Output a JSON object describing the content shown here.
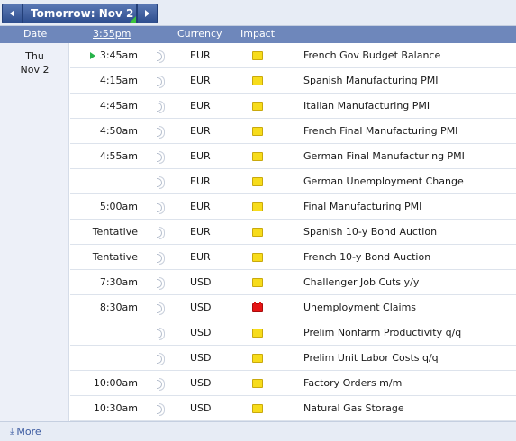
{
  "nav": {
    "prev_icon": "chevron-left-icon",
    "title": "Tomorrow: Nov 2",
    "next_icon": "chevron-right-icon"
  },
  "columns": {
    "date": "Date",
    "time": "3:55pm",
    "currency": "Currency",
    "impact": "Impact"
  },
  "day": {
    "weekday": "Thu",
    "date": "Nov 2"
  },
  "events": [
    {
      "time": "3:45am",
      "currency": "EUR",
      "impact": "low",
      "event": "French Gov Budget Balance",
      "next": true
    },
    {
      "time": "4:15am",
      "currency": "EUR",
      "impact": "low",
      "event": "Spanish Manufacturing PMI"
    },
    {
      "time": "4:45am",
      "currency": "EUR",
      "impact": "low",
      "event": "Italian Manufacturing PMI"
    },
    {
      "time": "4:50am",
      "currency": "EUR",
      "impact": "low",
      "event": "French Final Manufacturing PMI"
    },
    {
      "time": "4:55am",
      "currency": "EUR",
      "impact": "low",
      "event": "German Final Manufacturing PMI"
    },
    {
      "time": "",
      "currency": "EUR",
      "impact": "low",
      "event": "German Unemployment Change"
    },
    {
      "time": "5:00am",
      "currency": "EUR",
      "impact": "low",
      "event": "Final Manufacturing PMI"
    },
    {
      "time": "Tentative",
      "currency": "EUR",
      "impact": "low",
      "event": "Spanish 10-y Bond Auction"
    },
    {
      "time": "Tentative",
      "currency": "EUR",
      "impact": "low",
      "event": "French 10-y Bond Auction"
    },
    {
      "time": "7:30am",
      "currency": "USD",
      "impact": "low",
      "event": "Challenger Job Cuts y/y"
    },
    {
      "time": "8:30am",
      "currency": "USD",
      "impact": "high",
      "event": "Unemployment Claims"
    },
    {
      "time": "",
      "currency": "USD",
      "impact": "low",
      "event": "Prelim Nonfarm Productivity q/q"
    },
    {
      "time": "",
      "currency": "USD",
      "impact": "low",
      "event": "Prelim Unit Labor Costs q/q"
    },
    {
      "time": "10:00am",
      "currency": "USD",
      "impact": "low",
      "event": "Factory Orders m/m"
    },
    {
      "time": "10:30am",
      "currency": "USD",
      "impact": "low",
      "event": "Natural Gas Storage"
    }
  ],
  "impact_colors": {
    "low": "#f7dc1b",
    "high": "#e61515"
  },
  "footer": {
    "more_icon": "download-arrow-icon",
    "more_label": "More"
  }
}
